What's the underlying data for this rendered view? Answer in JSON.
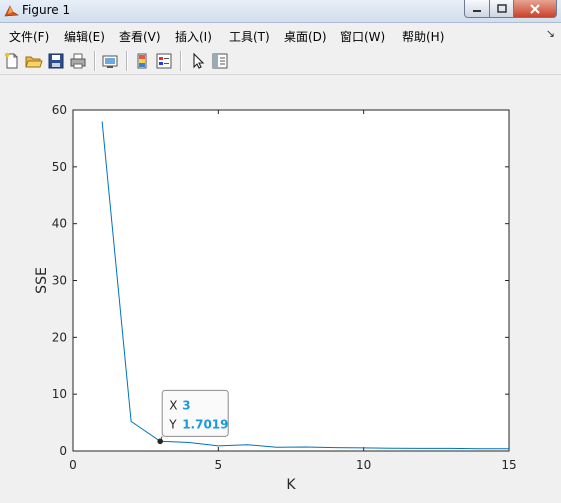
{
  "window": {
    "title": "Figure 1"
  },
  "menu": {
    "items": [
      "文件(F)",
      "编辑(E)",
      "查看(V)",
      "插入(I)",
      "工具(T)",
      "桌面(D)",
      "窗口(W)",
      "帮助(H)"
    ]
  },
  "toolbar": {
    "buttons": [
      "new-figure-icon",
      "open-folder-icon",
      "save-icon",
      "print-icon",
      "link-figure-icon",
      "colorbar-icon",
      "legend-icon",
      "pointer-icon",
      "property-editor-icon"
    ]
  },
  "colors": {
    "line": "#0072bd",
    "datatip_value": "#1a9bd7",
    "axes_bg": "#ffffff",
    "figure_bg": "#f0f0f0"
  },
  "chart_data": {
    "type": "line",
    "title": "",
    "xlabel": "K",
    "ylabel": "SSE",
    "xlim": [
      0,
      15
    ],
    "ylim": [
      0,
      60
    ],
    "xticks": [
      0,
      5,
      10,
      15
    ],
    "yticks": [
      0,
      10,
      20,
      30,
      40,
      50,
      60
    ],
    "grid": false,
    "series": [
      {
        "x": [
          1,
          2,
          3,
          4,
          5,
          6,
          7,
          8,
          9,
          10,
          11,
          12,
          13,
          14,
          15
        ],
        "y": [
          58,
          5.2,
          1.7019,
          1.5,
          0.9,
          1.1,
          0.65,
          0.7,
          0.6,
          0.55,
          0.5,
          0.45,
          0.45,
          0.4,
          0.4
        ]
      }
    ],
    "datatip": {
      "x_label": "X",
      "x_value": "3",
      "y_label": "Y",
      "y_value": "1.7019",
      "point": [
        3,
        1.7019
      ]
    }
  }
}
